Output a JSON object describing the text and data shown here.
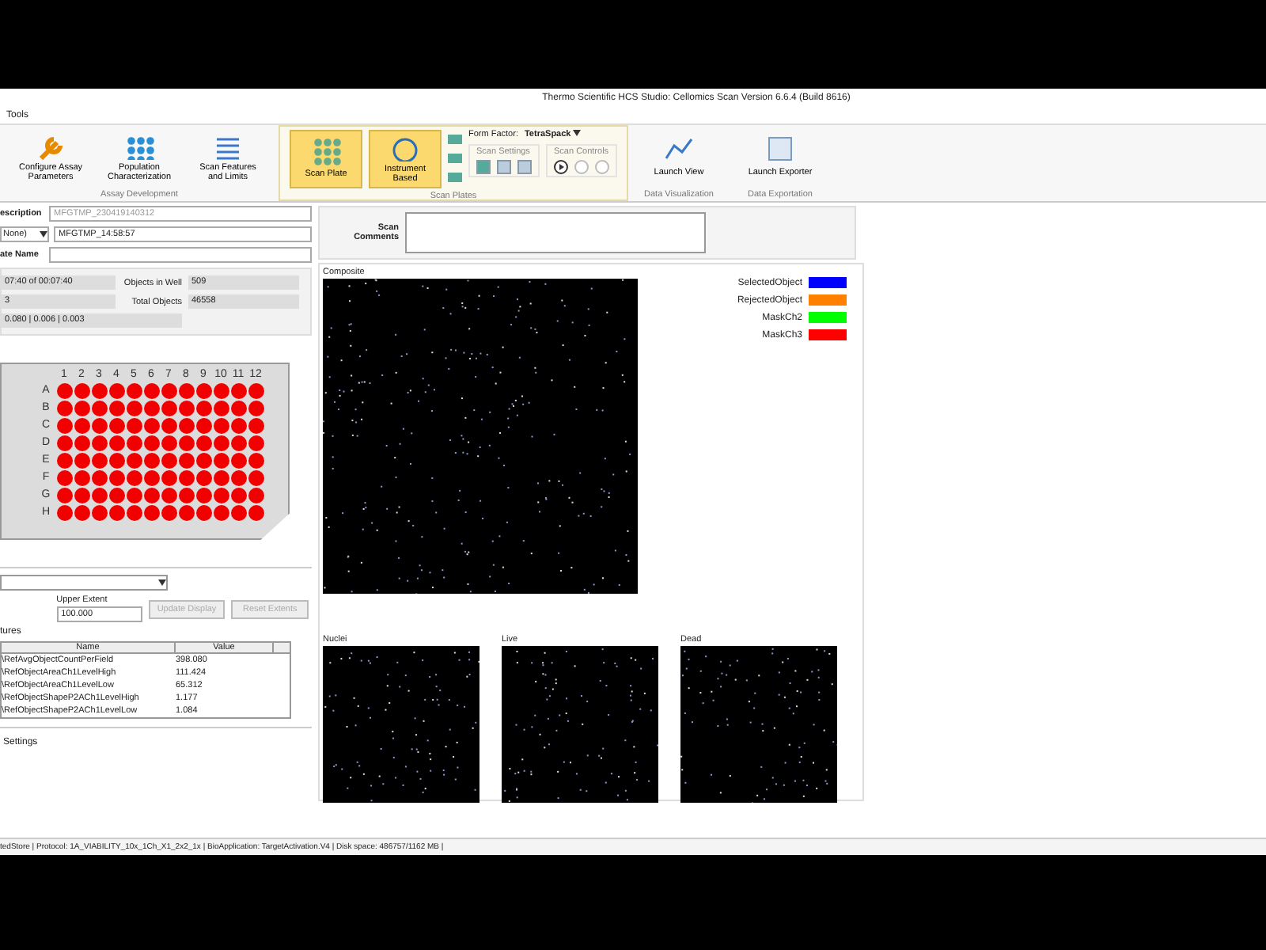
{
  "window": {
    "title": "Thermo Scientific HCS Studio: Cellomics Scan Version 6.6.4 (Build 8616)"
  },
  "menu": [
    "Tools"
  ],
  "ribbon": {
    "groups": [
      {
        "label": "Assay Development",
        "buttons": [
          {
            "label": "Configure Assay Parameters",
            "kind": "wrench",
            "selected": false
          },
          {
            "label": "Population Characterization",
            "kind": "grid",
            "selected": false
          },
          {
            "label": "Scan Features and Limits",
            "kind": "list",
            "selected": false
          }
        ]
      },
      {
        "label": "Scan Plates",
        "buttons": [
          {
            "label": "Scan Plate",
            "kind": "plate",
            "selected": true
          },
          {
            "label": "Instrument Based",
            "kind": "gauge",
            "selected": true
          }
        ],
        "form_factor_label": "Form Factor:",
        "form_factor": "TetraSpack",
        "scan_settings": "Scan Settings",
        "scan_controls": "Scan Controls"
      },
      {
        "label": "Data Visualization",
        "buttons": [
          {
            "label": "Launch View",
            "kind": "chart",
            "selected": false
          }
        ]
      },
      {
        "label": "Data Exportation",
        "buttons": [
          {
            "label": "Launch Exporter",
            "kind": "export",
            "selected": false
          }
        ]
      }
    ]
  },
  "form": {
    "description_label": "escription",
    "description": "MFGTMP_230419140312",
    "selector": "None)",
    "scan_name": "MFGTMP_14:58:57",
    "plate_name_label": "ate Name",
    "scan_comments_label": "Scan Comments"
  },
  "info": {
    "time": "07:40 of 00:07:40",
    "objects_label": "Objects in Well",
    "objects": "509",
    "field": "3",
    "total_label": "Total Objects",
    "total": "46558",
    "ratios": "0.080 | 0.006 | 0.003"
  },
  "plate": {
    "columns": [
      "1",
      "2",
      "3",
      "4",
      "5",
      "6",
      "7",
      "8",
      "9",
      "10",
      "11",
      "12"
    ],
    "rows": [
      "A",
      "B",
      "C",
      "D",
      "E",
      "F",
      "G",
      "H"
    ]
  },
  "extent": {
    "upper_label": "Upper Extent",
    "upper": "100.000",
    "update": "Update Display",
    "reset": "Reset Extents"
  },
  "features": {
    "label": "tures",
    "columns": [
      "Name",
      "Value"
    ],
    "rows": [
      {
        "name": "\\RefAvgObjectCountPerField",
        "value": "398.080"
      },
      {
        "name": "\\RefObjectAreaCh1LevelHigh",
        "value": "111.424"
      },
      {
        "name": "\\RefObjectAreaCh1LevelLow",
        "value": "65.312"
      },
      {
        "name": "\\RefObjectShapeP2ACh1LevelHigh",
        "value": "1.177"
      },
      {
        "name": "\\RefObjectShapeP2ACh1LevelLow",
        "value": "1.084"
      }
    ]
  },
  "settings_label": "Settings",
  "viewer": {
    "composite": "Composite",
    "legend": [
      {
        "label": "SelectedObject",
        "color": "#0000ff"
      },
      {
        "label": "RejectedObject",
        "color": "#ff8000"
      },
      {
        "label": "MaskCh2",
        "color": "#00ff00"
      },
      {
        "label": "MaskCh3",
        "color": "#ff0000"
      }
    ],
    "channels": [
      "Nuclei",
      "Live",
      "Dead"
    ]
  },
  "status_bar": "tedStore | Protocol: 1A_VIABILITY_10x_1Ch_X1_2x2_1x | BioApplication: TargetActivation.V4 | Disk space: 486757/1162 MB |"
}
